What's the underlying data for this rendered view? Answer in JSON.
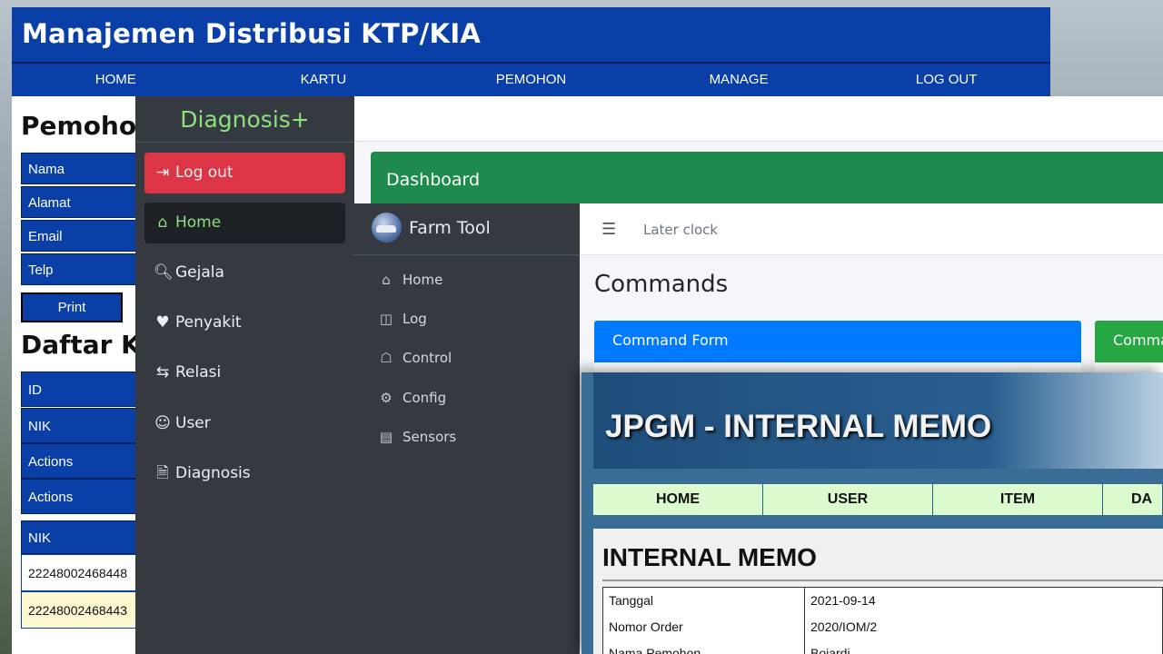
{
  "ktp": {
    "title": "Manajemen Distribusi KTP/KIA",
    "nav": [
      "HOME",
      "KARTU",
      "PEMOHON",
      "MANAGE",
      "LOG OUT"
    ],
    "section_pemohon": "Pemohon",
    "fields": [
      "Nama",
      "Alamat",
      "Email",
      "Telp"
    ],
    "print_label": "Print",
    "section_daftar": "Daftar KT",
    "table_headers": [
      "ID",
      "NIK",
      "Actions",
      "Actions"
    ],
    "nik_header": "NIK",
    "nik_rows": [
      "22248002468448",
      "22248002468443"
    ],
    "colors": {
      "primary": "#0a3fa8"
    }
  },
  "diagnosis": {
    "brand": "Diagnosis+",
    "menu": [
      {
        "label": "Log out",
        "icon": "logout-icon"
      },
      {
        "label": "Home",
        "icon": "home-icon"
      },
      {
        "label": "Gejala",
        "icon": "search-icon"
      },
      {
        "label": "Penyakit",
        "icon": "heart-icon"
      },
      {
        "label": "Relasi",
        "icon": "exchange-icon"
      },
      {
        "label": "User",
        "icon": "users-icon"
      },
      {
        "label": "Diagnosis",
        "icon": "file-icon"
      }
    ],
    "dashboard_title": "Dashboard",
    "colors": {
      "logout": "#dc3545",
      "accent": "#8ee07e",
      "dashboard": "#1e8a4c"
    }
  },
  "farm": {
    "brand": "Farm Tool",
    "menu": [
      {
        "label": "Home",
        "icon": "home-icon"
      },
      {
        "label": "Log",
        "icon": "columns-icon"
      },
      {
        "label": "Control",
        "icon": "control-icon"
      },
      {
        "label": "Config",
        "icon": "gear-icon"
      },
      {
        "label": "Sensors",
        "icon": "chip-icon"
      }
    ],
    "clock_label": "Later clock",
    "page_title": "Commands",
    "card_command_form": "Command Form",
    "card_second": "Comma",
    "colors": {
      "card1": "#007bff",
      "card2": "#28a745"
    }
  },
  "memo": {
    "banner_title": "JPGM - INTERNAL MEMO",
    "nav": [
      "HOME",
      "USER",
      "ITEM",
      "DA"
    ],
    "heading": "INTERNAL MEMO",
    "rows": [
      {
        "key": "Tanggal",
        "value": "2021-09-14"
      },
      {
        "key": "Nomor Order",
        "value": "2020/IOM/2"
      },
      {
        "key": "Nama Pemohon",
        "value": "Bojardi"
      }
    ],
    "colors": {
      "nav_bg": "#dcfcd0",
      "banner": "#2a5f8f"
    }
  }
}
